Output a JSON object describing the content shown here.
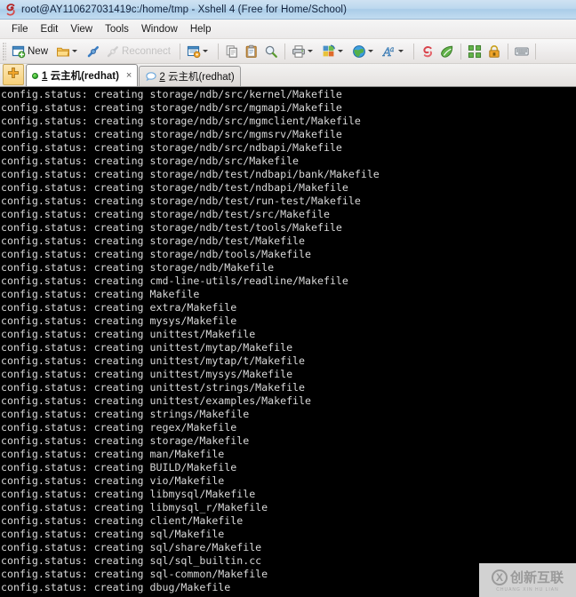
{
  "window": {
    "title": "root@AY110627031419c:/home/tmp - Xshell 4 (Free for Home/School)",
    "icon": "xshell-logo-icon"
  },
  "menubar": {
    "items": [
      {
        "label": "File"
      },
      {
        "label": "Edit"
      },
      {
        "label": "View"
      },
      {
        "label": "Tools"
      },
      {
        "label": "Window"
      },
      {
        "label": "Help"
      }
    ]
  },
  "toolbar": {
    "new_label": "New",
    "reconnect_label": "Reconnect",
    "items": [
      {
        "name": "new-session-button",
        "icon": "new-window-icon",
        "label": "New",
        "enabled": true
      },
      {
        "name": "open-session-button",
        "icon": "open-folder-icon",
        "label": "",
        "dropdown": true,
        "enabled": true
      },
      {
        "name": "connect-button",
        "icon": "connect-plug-icon",
        "label": "",
        "enabled": true
      },
      {
        "name": "reconnect-button",
        "icon": "reconnect-plug-icon",
        "label": "Reconnect",
        "enabled": false
      },
      {
        "name": "properties-button",
        "icon": "session-properties-icon",
        "label": "",
        "dropdown": true,
        "enabled": true
      },
      {
        "name": "copy-button",
        "icon": "copy-icon",
        "label": "",
        "enabled": true
      },
      {
        "name": "paste-button",
        "icon": "paste-clipboard-icon",
        "label": "",
        "enabled": true
      },
      {
        "name": "find-button",
        "icon": "magnifier-icon",
        "label": "",
        "enabled": true
      },
      {
        "name": "print-button",
        "icon": "printer-icon",
        "label": "",
        "dropdown": true,
        "enabled": true
      },
      {
        "name": "layout-button",
        "icon": "color-layout-icon",
        "label": "",
        "dropdown": true,
        "enabled": true
      },
      {
        "name": "globe-button",
        "icon": "globe-icon",
        "label": "",
        "dropdown": true,
        "enabled": true
      },
      {
        "name": "font-button",
        "icon": "font-letter-icon",
        "label": "",
        "dropdown": true,
        "enabled": true
      },
      {
        "name": "xshell-button",
        "icon": "xshell-red-icon",
        "label": "",
        "enabled": true
      },
      {
        "name": "xftp-button",
        "icon": "xftp-green-icon",
        "label": "",
        "enabled": true
      },
      {
        "name": "fullscreen-button",
        "icon": "fullscreen-arrows-icon",
        "label": "",
        "enabled": true
      },
      {
        "name": "lock-button",
        "icon": "lock-icon",
        "label": "",
        "enabled": true
      },
      {
        "name": "keyboard-button",
        "icon": "keyboard-icon",
        "label": "",
        "enabled": true
      }
    ]
  },
  "tabbar": {
    "new_tab_icon": "orange-plus-icon",
    "tabs": [
      {
        "number": "1",
        "title": " 云主机(redhat)",
        "active": true,
        "connected": true,
        "status_icon": "green-connected-dot",
        "close_glyph": "×"
      },
      {
        "number": "2",
        "title": " 云主机(redhat)",
        "active": false,
        "connected": false,
        "status_icon": "disconnected-bubble-icon",
        "close_glyph": ""
      }
    ]
  },
  "terminal": {
    "background": "#000000",
    "foreground": "#d8d8d8",
    "lines": [
      "config.status: creating storage/ndb/src/kernel/Makefile",
      "config.status: creating storage/ndb/src/mgmapi/Makefile",
      "config.status: creating storage/ndb/src/mgmclient/Makefile",
      "config.status: creating storage/ndb/src/mgmsrv/Makefile",
      "config.status: creating storage/ndb/src/ndbapi/Makefile",
      "config.status: creating storage/ndb/src/Makefile",
      "config.status: creating storage/ndb/test/ndbapi/bank/Makefile",
      "config.status: creating storage/ndb/test/ndbapi/Makefile",
      "config.status: creating storage/ndb/test/run-test/Makefile",
      "config.status: creating storage/ndb/test/src/Makefile",
      "config.status: creating storage/ndb/test/tools/Makefile",
      "config.status: creating storage/ndb/test/Makefile",
      "config.status: creating storage/ndb/tools/Makefile",
      "config.status: creating storage/ndb/Makefile",
      "config.status: creating cmd-line-utils/readline/Makefile",
      "config.status: creating Makefile",
      "config.status: creating extra/Makefile",
      "config.status: creating mysys/Makefile",
      "config.status: creating unittest/Makefile",
      "config.status: creating unittest/mytap/Makefile",
      "config.status: creating unittest/mytap/t/Makefile",
      "config.status: creating unittest/mysys/Makefile",
      "config.status: creating unittest/strings/Makefile",
      "config.status: creating unittest/examples/Makefile",
      "config.status: creating strings/Makefile",
      "config.status: creating regex/Makefile",
      "config.status: creating storage/Makefile",
      "config.status: creating man/Makefile",
      "config.status: creating BUILD/Makefile",
      "config.status: creating vio/Makefile",
      "config.status: creating libmysql/Makefile",
      "config.status: creating libmysql_r/Makefile",
      "config.status: creating client/Makefile",
      "config.status: creating sql/Makefile",
      "config.status: creating sql/share/Makefile",
      "config.status: creating sql/sql_builtin.cc",
      "config.status: creating sql-common/Makefile",
      "config.status: creating dbug/Makefile"
    ]
  },
  "watermark": {
    "cn_text": "创新互联",
    "en_text": "CHUANG XIN HU LIAN",
    "mark": "cx-circle-logo"
  }
}
